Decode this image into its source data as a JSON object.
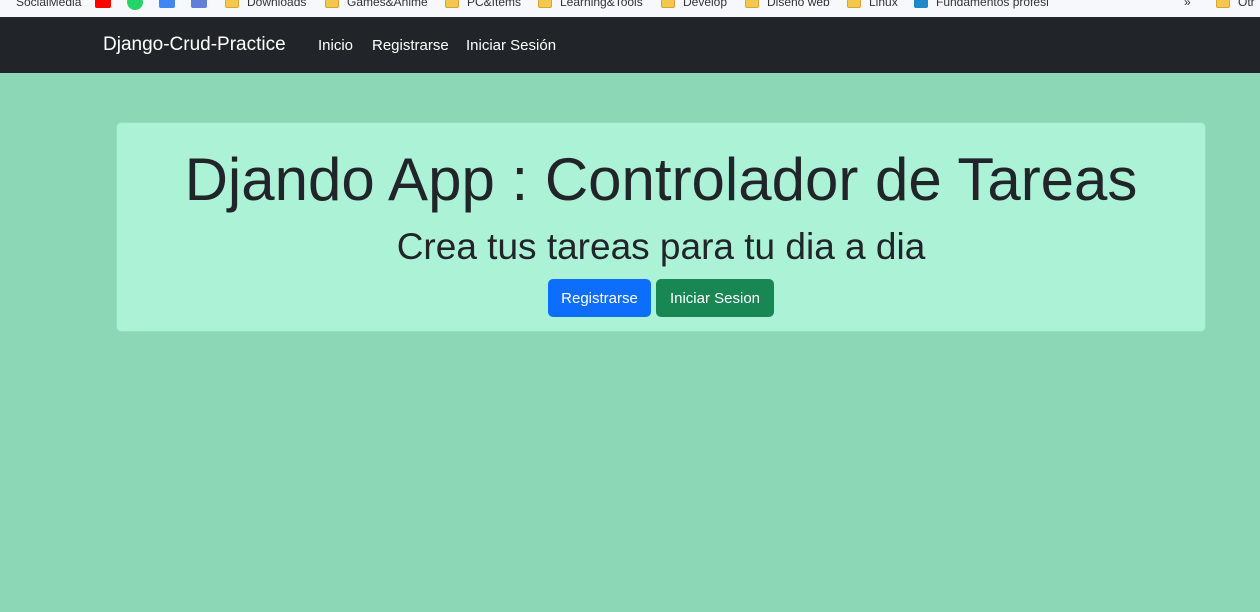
{
  "bookmarks": [
    {
      "label": "SocialMedia",
      "icon": "none"
    },
    {
      "label": "",
      "icon": "youtube-icon"
    },
    {
      "label": "",
      "icon": "whatsapp-icon"
    },
    {
      "label": "",
      "icon": "google-icon"
    },
    {
      "label": "",
      "icon": "app-icon"
    },
    {
      "label": "Downloads",
      "icon": "folder-icon"
    },
    {
      "label": "Games&Anime",
      "icon": "folder-icon"
    },
    {
      "label": "PC&Items",
      "icon": "folder-icon"
    },
    {
      "label": "Learning&Tools",
      "icon": "folder-icon"
    },
    {
      "label": "Develop",
      "icon": "folder-icon"
    },
    {
      "label": "Diseño web",
      "icon": "folder-icon"
    },
    {
      "label": "Linux",
      "icon": "folder-icon"
    },
    {
      "label": "Fundamentos profesi",
      "icon": "site-icon"
    },
    {
      "label": "»",
      "icon": "none"
    },
    {
      "label": "Otr",
      "icon": "folder-icon"
    }
  ],
  "navbar": {
    "brand": "Django-Crud-Practice",
    "links": [
      "Inicio",
      "Registrarse",
      "Iniciar Sesión"
    ]
  },
  "hero": {
    "title": "Djando App : Controlador de Tareas",
    "subtitle": "Crea tus tareas para tu dia a dia",
    "buttons": {
      "register": "Registrarse",
      "login": "Iniciar Sesion"
    }
  },
  "colors": {
    "page_background": "#8bd7b6",
    "card_background": "#acf2d6",
    "navbar": "#212529",
    "primary": "#0d6efd",
    "success": "#198754"
  }
}
